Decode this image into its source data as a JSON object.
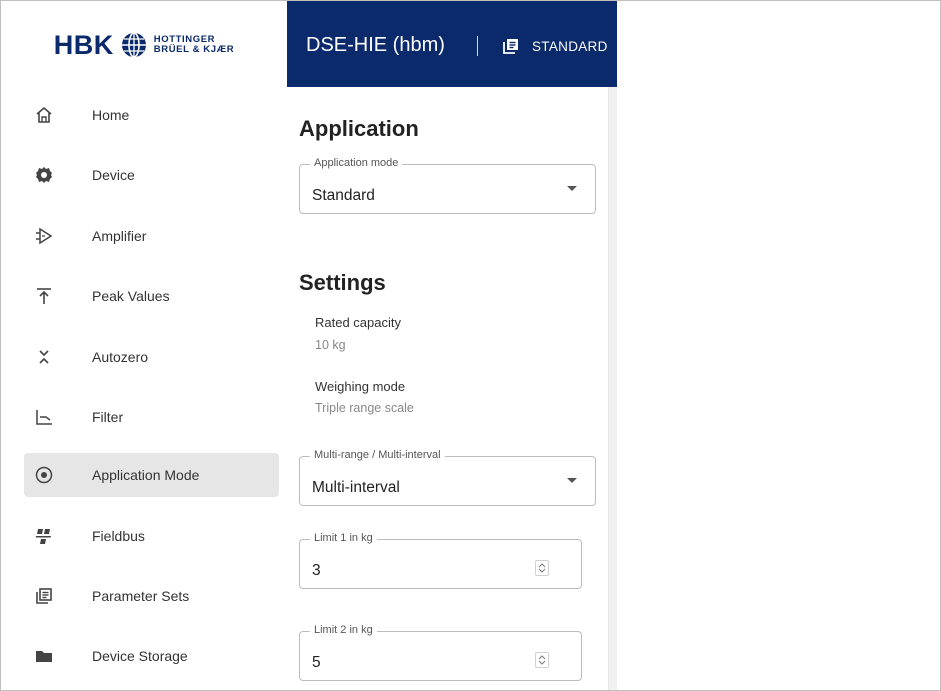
{
  "brand": {
    "logo_text": "HBK",
    "logo_sub_line1": "HOTTINGER",
    "logo_sub_line2": "BRÜEL & KJÆR",
    "header_bg": "#0b2a6b"
  },
  "header": {
    "device_title": "DSE-HIE (hbm)",
    "mode_icon": "parameter-sets-icon",
    "mode_label": "STANDARD"
  },
  "sidebar": {
    "active_color": "#e6e6e6",
    "items": [
      {
        "label": "Home",
        "icon": "home-icon",
        "active": false
      },
      {
        "label": "Device",
        "icon": "gear-icon",
        "active": false
      },
      {
        "label": "Amplifier",
        "icon": "amplifier-icon",
        "active": false
      },
      {
        "label": "Peak Values",
        "icon": "peak-values-icon",
        "active": false
      },
      {
        "label": "Autozero",
        "icon": "autozero-icon",
        "active": false
      },
      {
        "label": "Filter",
        "icon": "filter-icon",
        "active": false
      },
      {
        "label": "Application Mode",
        "icon": "application-mode-icon",
        "active": true
      },
      {
        "label": "Fieldbus",
        "icon": "fieldbus-icon",
        "active": false
      },
      {
        "label": "Parameter Sets",
        "icon": "parameter-sets-icon",
        "active": false
      },
      {
        "label": "Device Storage",
        "icon": "folder-icon",
        "active": false
      }
    ]
  },
  "application": {
    "heading": "Application",
    "mode_field": {
      "label": "Application mode",
      "value": "Standard"
    }
  },
  "settings": {
    "heading": "Settings",
    "rated_capacity": {
      "name": "Rated capacity",
      "value": "10 kg"
    },
    "weighing_mode": {
      "name": "Weighing mode",
      "value": "Triple range scale"
    },
    "multi_range": {
      "label": "Multi-range / Multi-interval",
      "value": "Multi-interval"
    },
    "limit1": {
      "label": "Limit 1 in kg",
      "value": "3"
    },
    "limit2": {
      "label": "Limit 2 in kg",
      "value": "5"
    }
  }
}
